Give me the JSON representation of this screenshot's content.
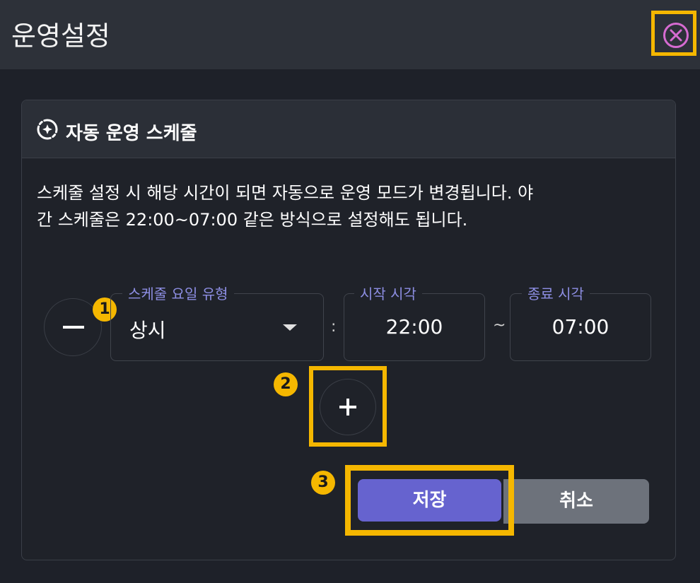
{
  "header": {
    "title": "운영설정",
    "close_icon": "close-circle-icon"
  },
  "panel": {
    "icon": "auto-schedule-icon",
    "title": "자동 운영 스케줄",
    "description_line1": "스케줄 설정 시 해당 시간이 되면 자동으로 운영 모드가 변경됩니다. 야",
    "description_line2": "간 스케줄은 22:00~07:00 같은 방식으로 설정해도 됩니다."
  },
  "schedule_row": {
    "remove_icon": "minus-icon",
    "day_type": {
      "label": "스케줄 요일 유형",
      "value": "상시",
      "icon": "dropdown-arrow-icon"
    },
    "separator_colon": ":",
    "start_time": {
      "label": "시작 시각",
      "value": "22:00"
    },
    "separator_tilde": "~",
    "end_time": {
      "label": "종료 시각",
      "value": "07:00"
    }
  },
  "add_icon": "plus-icon",
  "actions": {
    "save_label": "저장",
    "cancel_label": "취소"
  },
  "annotations": {
    "badge1": "1",
    "badge2": "2",
    "badge3": "3"
  },
  "colors": {
    "background": "#1e2129",
    "header_bg": "#2d3139",
    "accent_purple": "#6663cf",
    "label_purple": "#8d8ee3",
    "highlight_yellow": "#f5b700",
    "close_pink": "#d66bd1",
    "cancel_gray": "#6d727b"
  }
}
